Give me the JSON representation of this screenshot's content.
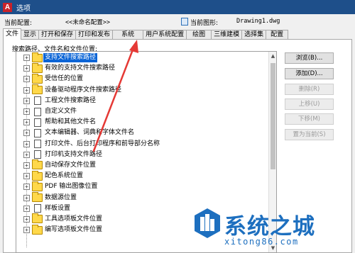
{
  "window": {
    "title": "选项",
    "app_icon_letter": "A"
  },
  "profile": {
    "current_config_label": "当前配置:",
    "current_config_value": "<<未命名配置>>",
    "current_drawing_label": "当前图形:",
    "current_drawing_value": "Drawing1.dwg"
  },
  "tabs": [
    {
      "label": "文件",
      "active": true
    },
    {
      "label": "显示"
    },
    {
      "label": "打开和保存"
    },
    {
      "label": "打印和发布"
    },
    {
      "label": "系统"
    },
    {
      "label": "用户系统配置"
    },
    {
      "label": "绘图"
    },
    {
      "label": "三维建模"
    },
    {
      "label": "选择集"
    },
    {
      "label": "配置"
    }
  ],
  "section_label": "搜索路径、文件名和文件位置:",
  "tree_items": [
    {
      "label": "支持文件搜索路径",
      "icon": "folder-icon",
      "selected": true
    },
    {
      "label": "有效的支持文件搜索路径",
      "icon": "folder-icon"
    },
    {
      "label": "受信任的位置",
      "icon": "folder-icon"
    },
    {
      "label": "设备驱动程序文件搜索路径",
      "icon": "folder-icon"
    },
    {
      "label": "工程文件搜索路径",
      "icon": "document-icon"
    },
    {
      "label": "自定义文件",
      "icon": "document-icon"
    },
    {
      "label": "帮助和其他文件名",
      "icon": "document-icon"
    },
    {
      "label": "文本编辑器、词典和字体文件名",
      "icon": "document-icon"
    },
    {
      "label": "打印文件、后台打印程序和前导部分名称",
      "icon": "document-icon"
    },
    {
      "label": "打印机支持文件路径",
      "icon": "document-icon"
    },
    {
      "label": "自动保存文件位置",
      "icon": "folder-icon"
    },
    {
      "label": "配色系统位置",
      "icon": "folder-icon"
    },
    {
      "label": "PDF 输出图像位置",
      "icon": "folder-icon"
    },
    {
      "label": "数据源位置",
      "icon": "folder-icon"
    },
    {
      "label": "样板设置",
      "icon": "document-icon"
    },
    {
      "label": "工具选项板文件位置",
      "icon": "folder-icon"
    },
    {
      "label": "编写选项板文件位置",
      "icon": "folder-icon"
    }
  ],
  "buttons": {
    "browse": "浏览(B)...",
    "add": "添加(D)...",
    "remove": "删除(R)",
    "move_up": "上移(U)",
    "move_down": "下移(M)",
    "set_current": "置为当前(S)"
  },
  "watermark": {
    "text": "系统之城",
    "url": "xitong86.com"
  },
  "colors": {
    "titlebar": "#1e4f8a",
    "selection": "#0a64d6",
    "arrow": "#e53935",
    "watermark": "#1d6fbf"
  }
}
